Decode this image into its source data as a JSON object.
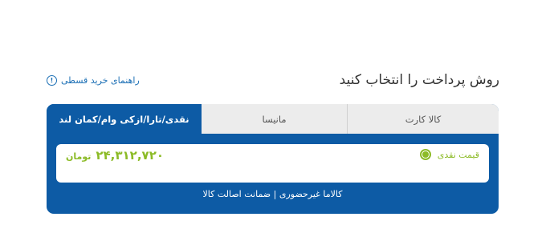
{
  "header": {
    "title": "روش پرداخت را انتخاب کنید",
    "guide_link": "راهنمای خرید قسطی",
    "guide_icon": "info-icon"
  },
  "tabs": [
    {
      "label": "نقدی/تارا/ازکی وام/کمان لند",
      "active": true
    },
    {
      "label": "مانیسا",
      "active": false
    },
    {
      "label": "کالا کارت",
      "active": false
    }
  ],
  "payment": {
    "option_label": "قیمت نقدی",
    "selected": true,
    "amount": "۲۴,۳۱۲,۷۲۰",
    "currency": "تومان"
  },
  "footer": {
    "note": "کالاما غیرحضوری | ضمانت اصالت کالا"
  },
  "colors": {
    "primary": "#0d5ba5",
    "accent": "#8cbb27",
    "link": "#1b6fb5"
  }
}
